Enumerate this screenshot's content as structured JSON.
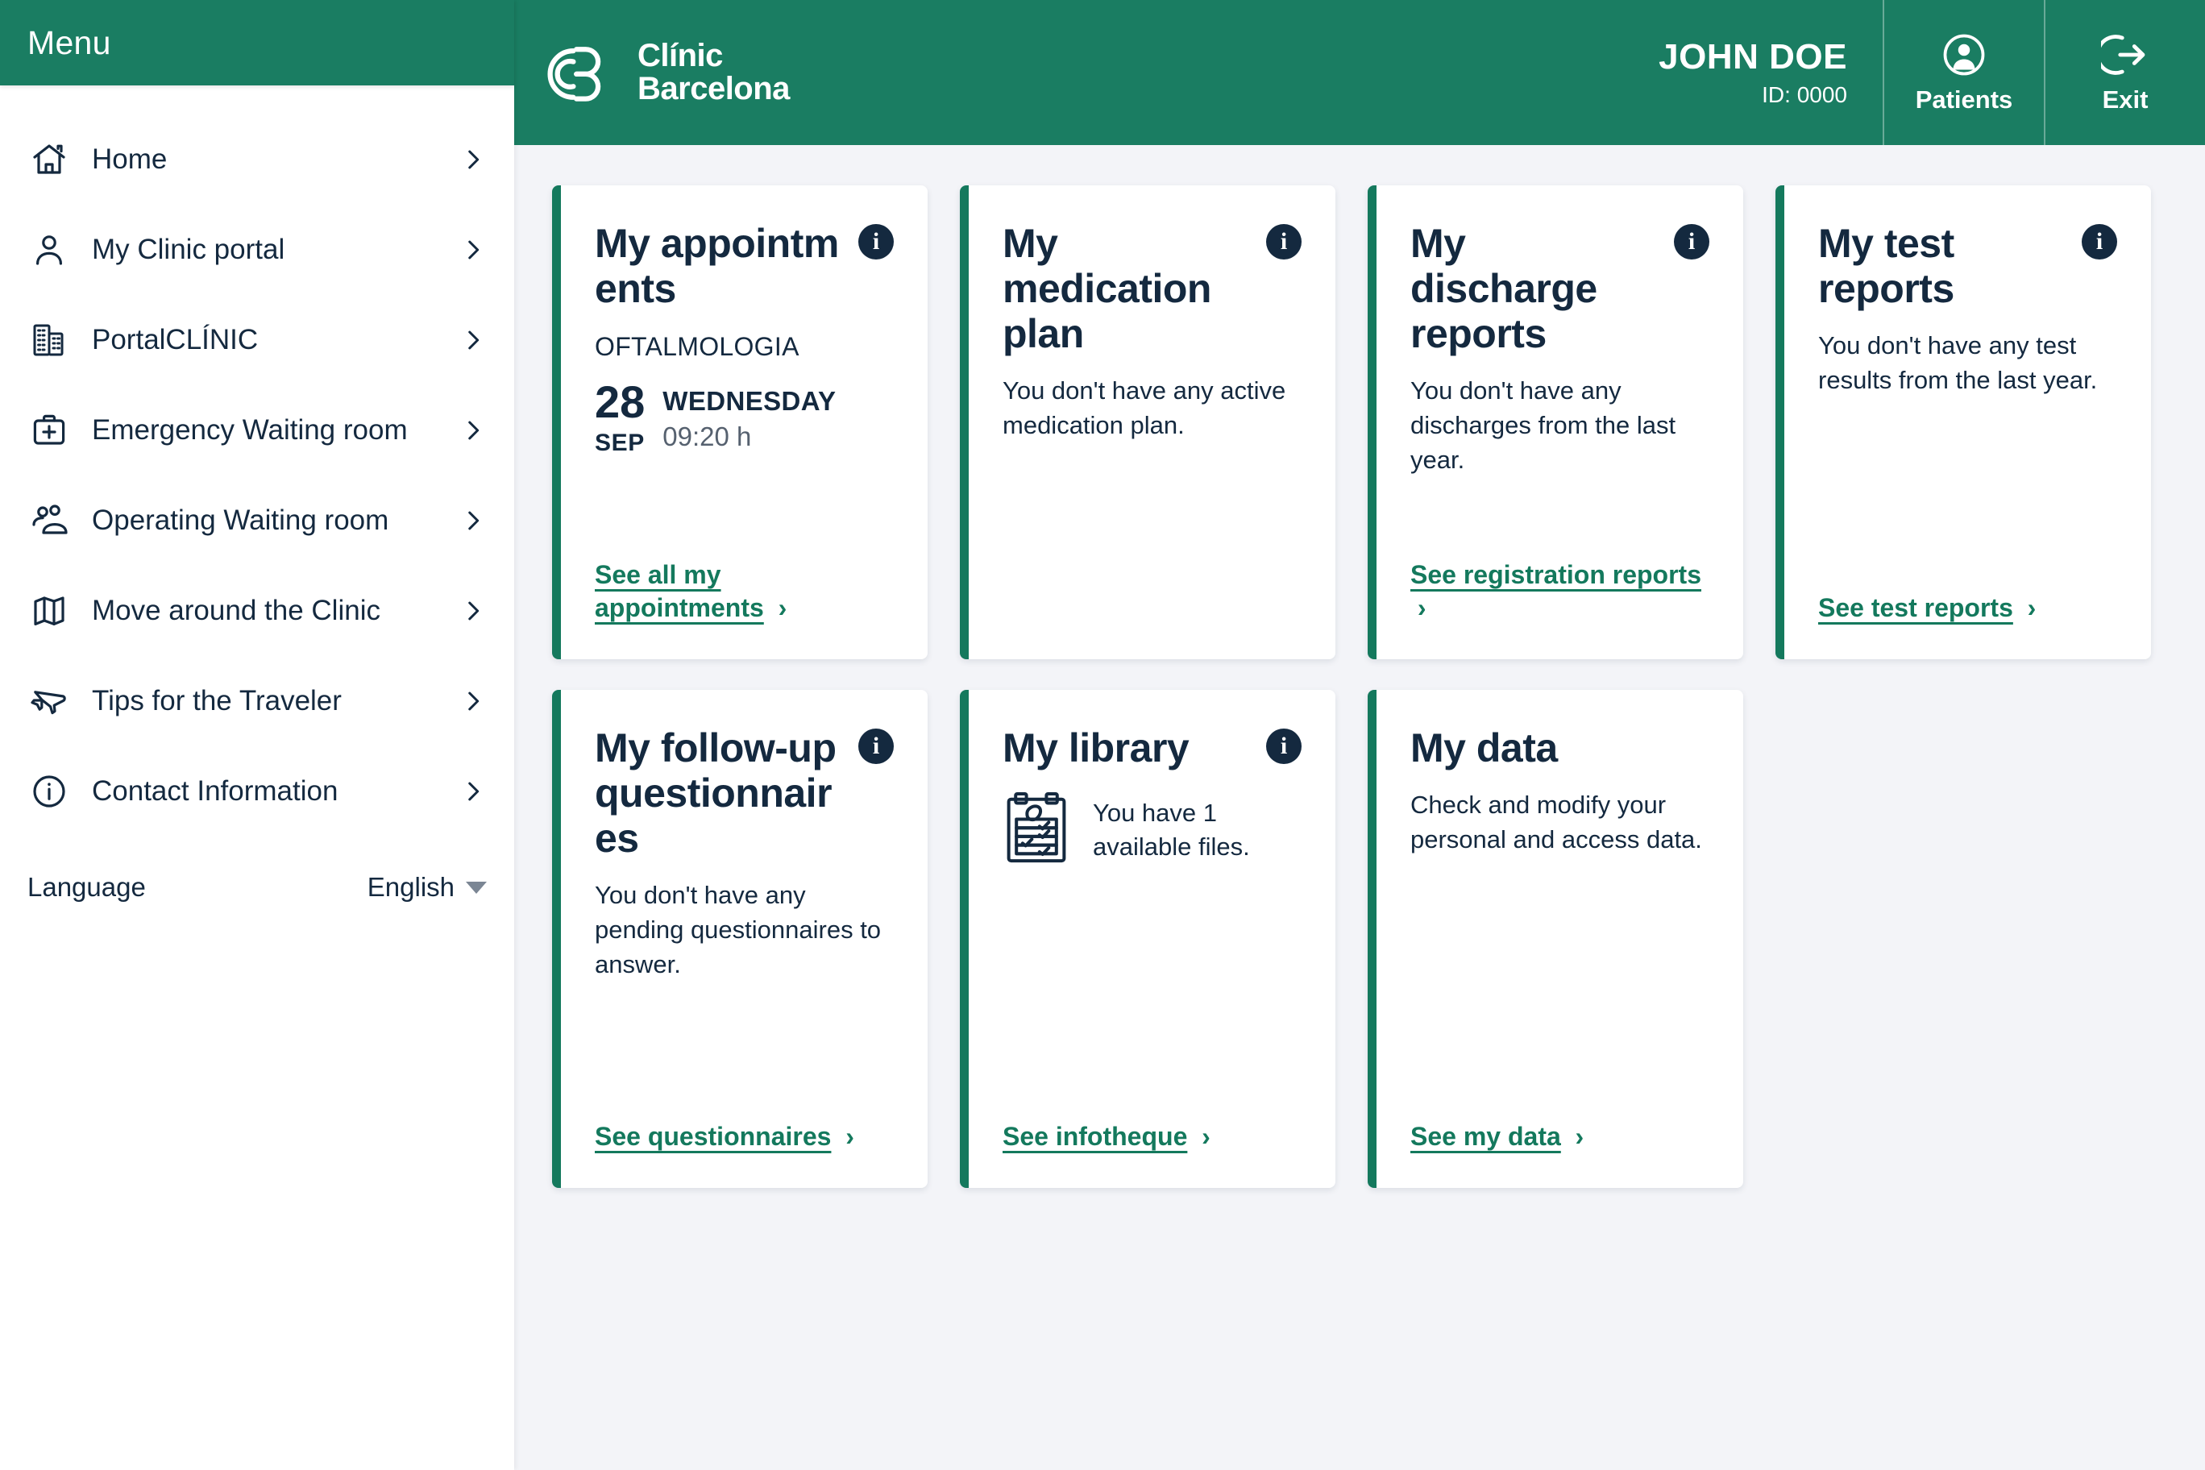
{
  "sidebar": {
    "header_label": "Menu",
    "items": [
      {
        "label": "Home",
        "icon": "home-icon"
      },
      {
        "label": "My Clinic portal",
        "icon": "user-icon"
      },
      {
        "label": "PortalCLÍNIC",
        "icon": "building-icon"
      },
      {
        "label": "Emergency Waiting room",
        "icon": "first-aid-kit-icon"
      },
      {
        "label": "Operating Waiting room",
        "icon": "people-icon"
      },
      {
        "label": "Move around the Clinic",
        "icon": "map-icon"
      },
      {
        "label": "Tips for the Traveler",
        "icon": "airplane-icon"
      },
      {
        "label": "Contact Information",
        "icon": "info-circle-icon"
      }
    ],
    "language": {
      "label": "Language",
      "value": "English"
    }
  },
  "topbar": {
    "brand": {
      "line1": "Clínic",
      "line2": "Barcelona"
    },
    "user": {
      "name": "JOHN DOE",
      "id": "ID: 0000"
    },
    "actions": [
      {
        "label": "Patients",
        "icon": "user-circle-icon"
      },
      {
        "label": "Exit",
        "icon": "exit-arrow-icon"
      }
    ]
  },
  "cards": [
    {
      "title": "My appointments",
      "specialty": "OFTALMOLOGIA",
      "day": "28",
      "month": "SEP",
      "weekday": "WEDNESDAY",
      "time": "09:20 h",
      "link": "See all my appointments",
      "info_badge": "i"
    },
    {
      "title": "My medication plan",
      "body": "You don't have any active medication plan.",
      "info_badge": "i"
    },
    {
      "title": "My discharge reports",
      "body": "You don't have any discharges from the last year.",
      "link": "See registration reports",
      "info_badge": "i"
    },
    {
      "title": "My test reports",
      "body": "You don't have any test results from the last year.",
      "link": "See test reports",
      "info_badge": "i"
    },
    {
      "title": "My follow-up questionnaires",
      "body": "You don't have any pending questionnaires to answer.",
      "link": "See questionnaires",
      "info_badge": "i"
    },
    {
      "title": "My library",
      "body": "You have 1 available files.",
      "link": "See infotheque",
      "info_badge": "i",
      "icon": "clipboard-checklist-icon"
    },
    {
      "title": "My data",
      "body": "Check and modify your personal and access data.",
      "link": "See my data"
    }
  ],
  "colors": {
    "brand_green": "#1a7d62",
    "accent_green": "#14795d",
    "navy": "#14293f",
    "page_bg": "#f3f4f8"
  }
}
